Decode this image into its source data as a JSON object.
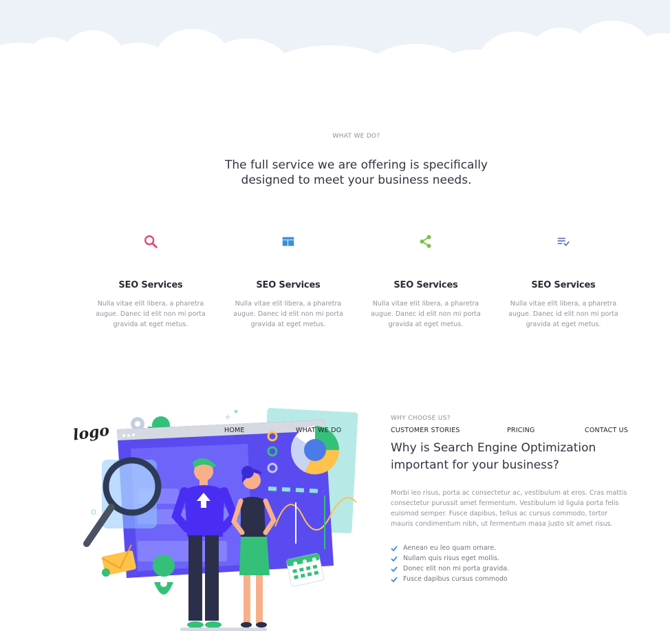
{
  "what_we_do": {
    "eyebrow": "WHAT WE DO?",
    "title_line1": "The full service we are offering is specifically",
    "title_line2": "designed to meet your business needs."
  },
  "services": [
    {
      "icon": "search-icon",
      "title": "SEO Services",
      "text": "Nulla vitae elit libera, a pharetra augue. Danec id elit non mi porta gravida at eget metus.",
      "color": "#e0457b"
    },
    {
      "icon": "layout-icon",
      "title": "SEO Services",
      "text": "Nulla vitae elit libera, a pharetra augue. Danec id elit non mi porta gravida at eget metus.",
      "color": "#3b8fd6"
    },
    {
      "icon": "share-icon",
      "title": "SEO Services",
      "text": "Nulla vitae elit libera, a pharetra augue. Danec id elit non mi porta gravida at eget metus.",
      "color": "#7bbf4f"
    },
    {
      "icon": "checklist-icon",
      "title": "SEO Services",
      "text": "Nulla vitae elit libera, a pharetra augue. Danec id elit non mi porta gravida at eget metus.",
      "color": "#5a6ebd"
    }
  ],
  "nav": {
    "logo": "logo",
    "home": "HOME",
    "what_we_do": "WHAT WE DO",
    "customer_stories": "CUSTOMER STORIES",
    "pricing": "PRICING",
    "contact_us": "CONTACT US"
  },
  "why": {
    "eyebrow": "WHY CHOOSE US?",
    "title_line1": "Why is Search Engine Optimization",
    "title_line2": "important for your business?",
    "body": "Morbi leo risus, porta ac consectetur ac, vestibulum at eros. Cras mattis consectetur purussit amet fermentum. Vestibulum id ligula porta felis euismod semper. Fusce dapibus, tellus ac cursus commodo, tortor mauris condimentum nibh, ut fermentum masa justo sit amet risus.",
    "bullets": [
      "Aenean eu leo quam ornare.",
      "Nullam quis risus eget mollis.",
      "Donec elit non mi porta gravida.",
      "Fusce dapibus cursus commodo"
    ],
    "check_color": "#3b8fd6"
  }
}
